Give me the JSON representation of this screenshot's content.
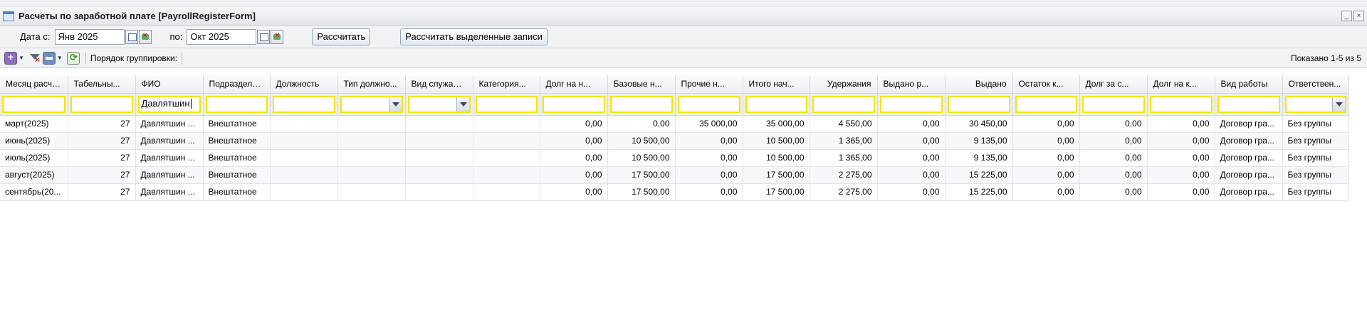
{
  "window": {
    "title": "Расчеты по заработной плате [PayrollRegisterForm]",
    "min_glyph": "_",
    "close_glyph": "×"
  },
  "params": {
    "date_from_label": "Дата с:",
    "date_from_value": "Янв 2025",
    "date_to_label": "по:",
    "date_to_value": "Окт 2025",
    "calc_button": "Рассчитать",
    "calc_selected_button": "Рассчитать выделенные записи"
  },
  "toolbar": {
    "grouping_label": "Порядок группировки:",
    "shown_text": "Показано 1-5 из 5"
  },
  "grid": {
    "columns": [
      "Месяц расче...",
      "Табельны...",
      "ФИО",
      "Подразделе...",
      "Должность",
      "Тип должно...",
      "Вид служащ...",
      "Категория...",
      "Долг на н...",
      "Базовые н...",
      "Прочие н...",
      "Итого нач...",
      "Удержания",
      "Выдано р...",
      "Выдано",
      "Остаток к...",
      "Долг за с...",
      "Долг на к...",
      "Вид работы",
      "Ответствен..."
    ],
    "filters": {
      "fio": "Давлятшин"
    },
    "rows": [
      [
        "март(2025)",
        "27",
        "Давлятшин ...",
        "Внештатное",
        "",
        "",
        "",
        "",
        "0,00",
        "0,00",
        "35 000,00",
        "35 000,00",
        "4 550,00",
        "0,00",
        "30 450,00",
        "0,00",
        "0,00",
        "0,00",
        "Договор гра...",
        "Без группы"
      ],
      [
        "июнь(2025)",
        "27",
        "Давлятшин ...",
        "Внештатное",
        "",
        "",
        "",
        "",
        "0,00",
        "10 500,00",
        "0,00",
        "10 500,00",
        "1 365,00",
        "0,00",
        "9 135,00",
        "0,00",
        "0,00",
        "0,00",
        "Договор гра...",
        "Без группы"
      ],
      [
        "июль(2025)",
        "27",
        "Давлятшин ...",
        "Внештатное",
        "",
        "",
        "",
        "",
        "0,00",
        "10 500,00",
        "0,00",
        "10 500,00",
        "1 365,00",
        "0,00",
        "9 135,00",
        "0,00",
        "0,00",
        "0,00",
        "Договор гра...",
        "Без группы"
      ],
      [
        "август(2025)",
        "27",
        "Давлятшин ...",
        "Внештатное",
        "",
        "",
        "",
        "",
        "0,00",
        "17 500,00",
        "0,00",
        "17 500,00",
        "2 275,00",
        "0,00",
        "15 225,00",
        "0,00",
        "0,00",
        "0,00",
        "Договор гра...",
        "Без группы"
      ],
      [
        "сентябрь(20...",
        "27",
        "Давлятшин ...",
        "Внештатное",
        "",
        "",
        "",
        "",
        "0,00",
        "17 500,00",
        "0,00",
        "17 500,00",
        "2 275,00",
        "0,00",
        "15 225,00",
        "0,00",
        "0,00",
        "0,00",
        "Договор гра...",
        "Без группы"
      ]
    ]
  }
}
